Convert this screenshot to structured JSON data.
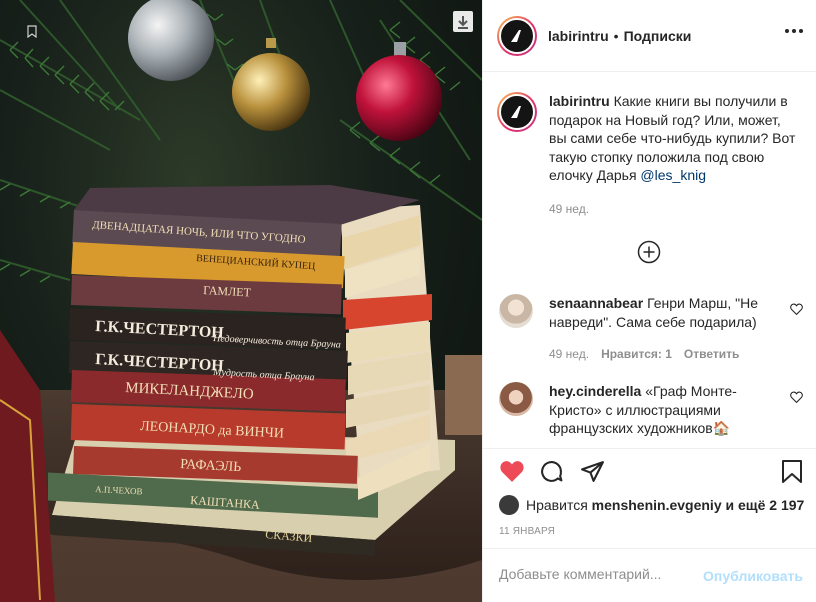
{
  "post": {
    "username": "labirintru",
    "separator": "•",
    "follow_label": "Подписки",
    "more_icon": "more-horizontal-icon"
  },
  "photo": {
    "book_titles": [
      "ДВЕНАДЦАТАЯ НОЧЬ, ИЛИ ЧТО УГОДНО",
      "ВЕНЕЦИАНСКИЙ КУПЕЦ",
      "ГАМЛЕТ",
      "Г.К.ЧЕСТЕРТОН",
      "Недоверчивость отца Брауна",
      "Г.К.ЧЕСТЕРТОН",
      "Мудрость отца Брауна",
      "МИКЕЛАНДЖЕЛО",
      "ЛЕОНАРДО да ВИНЧИ",
      "РАФАЭЛЬ",
      "А.П.ЧЕХОВ",
      "КАШТАНКА",
      "СКАЗКИ"
    ]
  },
  "caption": {
    "username": "labirintru",
    "text": "Какие книги вы получили в подарок на Новый год? Или, может, вы сами себе что-нибудь купили? Вот такую стопку положила под свою елочку Дарья",
    "mention": "@les_knig",
    "time": "49 нед."
  },
  "load_more_icon": "plus-circle-icon",
  "comments": [
    {
      "username": "senaannabear",
      "text": "Генри Марш, \"Не навреди\". Сама себе подарила)",
      "time": "49 нед.",
      "likes": "Нравится: 1",
      "reply": "Ответить"
    },
    {
      "username": "hey.cinderella",
      "text": "«Граф Монте-Кристо» с иллюстрациями французских художников🏠"
    }
  ],
  "likes": {
    "prefix": "Нравится",
    "user": "menshenin.evgeniy",
    "suffix": "и ещё 2 197"
  },
  "date": "11 ЯНВАРЯ",
  "add_comment": {
    "placeholder": "Добавьте комментарий...",
    "publish": "Опубликовать"
  },
  "colors": {
    "like_red": "#ed4956",
    "link": "#00376b",
    "publish_disabled": "#b2dffc",
    "muted": "#8e8e8e"
  }
}
